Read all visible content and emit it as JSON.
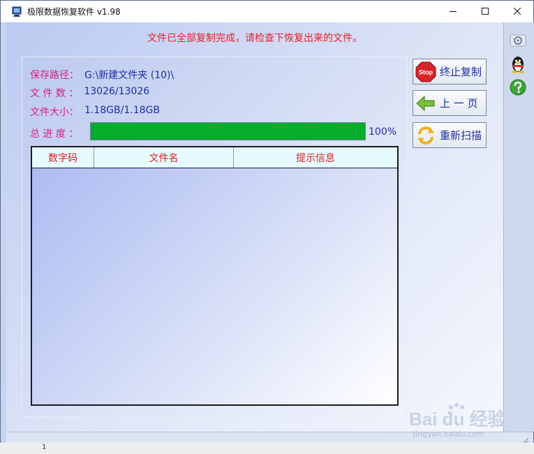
{
  "window": {
    "title": "极限数据恢复软件 v1.98"
  },
  "status_message": "文件已全部复制完成，请检查下恢复出来的文件。",
  "info": {
    "path_label": "保存路径：",
    "path_value": "G:\\新建文件夹 (10)\\",
    "count_label": "文 件 数 ：",
    "count_value": "13026/13026",
    "size_label": "文件大小：",
    "size_value": "1.18GB/1.18GB",
    "progress_label": "总 进 度 ："
  },
  "progress": {
    "percent": 100,
    "percent_text": "100%"
  },
  "table": {
    "columns": [
      "数字码",
      "文件名",
      "提示信息"
    ],
    "rows": []
  },
  "buttons": {
    "stop_label": "终止复制",
    "stop_icon_text": "Stop",
    "prev_label": "上 一 页",
    "rescan_label": "重新扫描"
  },
  "statusbar": {
    "left_number": "1"
  },
  "watermark": {
    "main": "Bai du 经验",
    "sub": "jingyan.baidu.com"
  },
  "colors": {
    "progress_fill": "#06ad2a",
    "status_red": "#e8202a",
    "label_magenta": "#d8208a",
    "value_blue": "#1d2fa0"
  }
}
